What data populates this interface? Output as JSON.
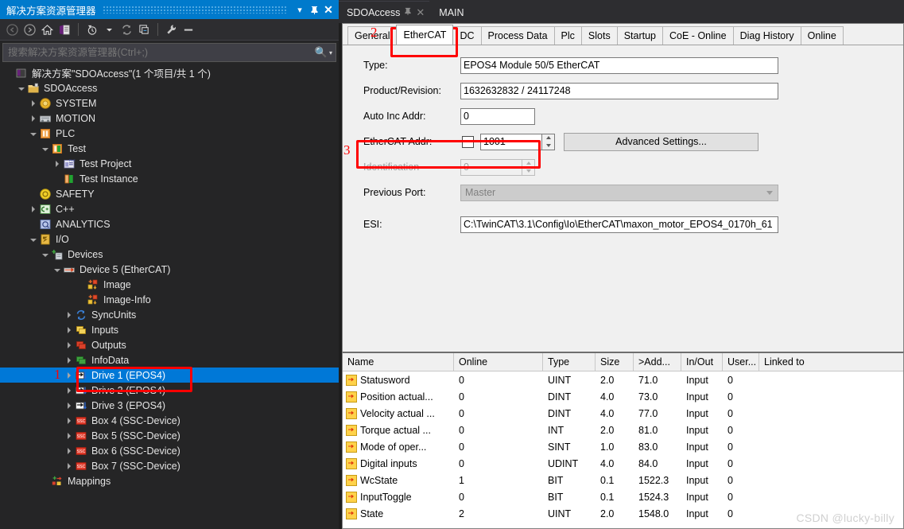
{
  "solution_explorer": {
    "title": "解决方案资源管理器",
    "titlebar_buttons": [
      {
        "name": "dropdown",
        "glyph": "▾"
      },
      {
        "name": "pin",
        "glyph": "⚲"
      },
      {
        "name": "close",
        "glyph": "✕"
      }
    ],
    "toolbar": [
      {
        "name": "back-icon",
        "glyph": "←"
      },
      {
        "name": "forward-icon",
        "glyph": "→"
      },
      {
        "name": "home-icon",
        "glyph": "⌂"
      },
      {
        "name": "solution-icon",
        "glyph": ""
      },
      {
        "name": "pending-changes-icon",
        "glyph": ""
      },
      {
        "name": "refresh-icon",
        "glyph": "⟳"
      },
      {
        "name": "collapse-all-icon",
        "glyph": ""
      },
      {
        "name": "properties-wrench-icon",
        "glyph": ""
      },
      {
        "name": "dash-icon",
        "glyph": "▬"
      }
    ],
    "search_placeholder": "搜索解决方案资源管理器(Ctrl+;)",
    "tree": [
      {
        "label": "解决方案\"SDOAccess\"(1 个项目/共 1 个)",
        "indent": 0,
        "twisty": "",
        "icon": "solution"
      },
      {
        "label": "SDOAccess",
        "indent": 1,
        "twisty": "open",
        "icon": "project"
      },
      {
        "label": "SYSTEM",
        "indent": 2,
        "twisty": "closed",
        "icon": "system"
      },
      {
        "label": "MOTION",
        "indent": 2,
        "twisty": "closed",
        "icon": "motion"
      },
      {
        "label": "PLC",
        "indent": 2,
        "twisty": "open",
        "icon": "plc"
      },
      {
        "label": "Test",
        "indent": 3,
        "twisty": "open",
        "icon": "plcproj"
      },
      {
        "label": "Test Project",
        "indent": 4,
        "twisty": "closed",
        "icon": "plcprog"
      },
      {
        "label": "Test Instance",
        "indent": 4,
        "twisty": "",
        "icon": "plcinst"
      },
      {
        "label": "SAFETY",
        "indent": 2,
        "twisty": "",
        "icon": "safety"
      },
      {
        "label": "C++",
        "indent": 2,
        "twisty": "closed",
        "icon": "cpp"
      },
      {
        "label": "ANALYTICS",
        "indent": 2,
        "twisty": "",
        "icon": "analytics"
      },
      {
        "label": "I/O",
        "indent": 2,
        "twisty": "open",
        "icon": "io"
      },
      {
        "label": "Devices",
        "indent": 3,
        "twisty": "open",
        "icon": "devices"
      },
      {
        "label": "Device 5 (EtherCAT)",
        "indent": 4,
        "twisty": "open",
        "icon": "ecatdev"
      },
      {
        "label": "Image",
        "indent": 6,
        "twisty": "",
        "icon": "image"
      },
      {
        "label": "Image-Info",
        "indent": 6,
        "twisty": "",
        "icon": "image"
      },
      {
        "label": "SyncUnits",
        "indent": 5,
        "twisty": "closed",
        "icon": "sync"
      },
      {
        "label": "Inputs",
        "indent": 5,
        "twisty": "closed",
        "icon": "inputs"
      },
      {
        "label": "Outputs",
        "indent": 5,
        "twisty": "closed",
        "icon": "outputs"
      },
      {
        "label": "InfoData",
        "indent": 5,
        "twisty": "closed",
        "icon": "infodata"
      },
      {
        "label": "Drive 1 (EPOS4)",
        "indent": 5,
        "twisty": "closed",
        "icon": "drive",
        "selected": true
      },
      {
        "label": "Drive 2 (EPOS4)",
        "indent": 5,
        "twisty": "closed",
        "icon": "drive"
      },
      {
        "label": "Drive 3 (EPOS4)",
        "indent": 5,
        "twisty": "closed",
        "icon": "drive"
      },
      {
        "label": "Box 4 (SSC-Device)",
        "indent": 5,
        "twisty": "closed",
        "icon": "ssc"
      },
      {
        "label": "Box 5 (SSC-Device)",
        "indent": 5,
        "twisty": "closed",
        "icon": "ssc"
      },
      {
        "label": "Box 6 (SSC-Device)",
        "indent": 5,
        "twisty": "closed",
        "icon": "ssc"
      },
      {
        "label": "Box 7 (SSC-Device)",
        "indent": 5,
        "twisty": "closed",
        "icon": "ssc"
      },
      {
        "label": "Mappings",
        "indent": 3,
        "twisty": "",
        "icon": "mappings"
      }
    ]
  },
  "document_tabs": [
    {
      "label": "SDOAccess",
      "active": true,
      "pin": "⚲",
      "close": "✕"
    },
    {
      "label": "MAIN",
      "active": false
    }
  ],
  "property_tabs": [
    {
      "label": "General",
      "active": false
    },
    {
      "label": "EtherCAT",
      "active": true
    },
    {
      "label": "DC",
      "active": false
    },
    {
      "label": "Process Data",
      "active": false
    },
    {
      "label": "Plc",
      "active": false
    },
    {
      "label": "Slots",
      "active": false
    },
    {
      "label": "Startup",
      "active": false
    },
    {
      "label": "CoE - Online",
      "active": false
    },
    {
      "label": "Diag History",
      "active": false
    },
    {
      "label": "Online",
      "active": false
    }
  ],
  "form": {
    "type_label": "Type:",
    "type_value": "EPOS4 Module 50/5 EtherCAT",
    "product_label": "Product/Revision:",
    "product_value": "1632632832 / 24117248",
    "autoinc_label": "Auto Inc Addr:",
    "autoinc_value": "0",
    "ecataddr_label": "EtherCAT Addr:",
    "ecataddr_value": "1001",
    "identification_label": "Identification",
    "identification_value": "0",
    "prevport_label": "Previous Port:",
    "prevport_value": "Master",
    "esi_label": "ESI:",
    "esi_value": "C:\\TwinCAT\\3.1\\Config\\Io\\EtherCAT\\maxon_motor_EPOS4_0170h_61",
    "advanced_button": "Advanced Settings..."
  },
  "grid": {
    "columns": [
      "Name",
      "Online",
      "Type",
      "Size",
      ">Add...",
      "In/Out",
      "User...",
      "Linked to"
    ],
    "rows": [
      {
        "name": "Statusword",
        "online": "0",
        "type": "UINT",
        "size": "2.0",
        "addr": "71.0",
        "inout": "Input",
        "user": "0",
        "linked": ""
      },
      {
        "name": "Position actual...",
        "online": "0",
        "type": "DINT",
        "size": "4.0",
        "addr": "73.0",
        "inout": "Input",
        "user": "0",
        "linked": ""
      },
      {
        "name": "Velocity actual ...",
        "online": "0",
        "type": "DINT",
        "size": "4.0",
        "addr": "77.0",
        "inout": "Input",
        "user": "0",
        "linked": ""
      },
      {
        "name": "Torque actual ...",
        "online": "0",
        "type": "INT",
        "size": "2.0",
        "addr": "81.0",
        "inout": "Input",
        "user": "0",
        "linked": ""
      },
      {
        "name": "Mode of oper...",
        "online": "0",
        "type": "SINT",
        "size": "1.0",
        "addr": "83.0",
        "inout": "Input",
        "user": "0",
        "linked": ""
      },
      {
        "name": "Digital inputs",
        "online": "0",
        "type": "UDINT",
        "size": "4.0",
        "addr": "84.0",
        "inout": "Input",
        "user": "0",
        "linked": ""
      },
      {
        "name": "WcState",
        "online": "1",
        "type": "BIT",
        "size": "0.1",
        "addr": "1522.3",
        "inout": "Input",
        "user": "0",
        "linked": ""
      },
      {
        "name": "InputToggle",
        "online": "0",
        "type": "BIT",
        "size": "0.1",
        "addr": "1524.3",
        "inout": "Input",
        "user": "0",
        "linked": ""
      },
      {
        "name": "State",
        "online": "2",
        "type": "UINT",
        "size": "2.0",
        "addr": "1548.0",
        "inout": "Input",
        "user": "0",
        "linked": ""
      }
    ]
  },
  "annotations": [
    {
      "number": "1",
      "target": "drive-1-tree-item"
    },
    {
      "number": "2",
      "target": "ethercat-property-tab"
    },
    {
      "number": "3",
      "target": "ethercat-addr-field"
    }
  ],
  "watermark": "CSDN @lucky-billy",
  "colors": {
    "accent_blue": "#007acc",
    "selection_blue": "#0078d7",
    "annotation_red": "#fe0000",
    "panel_bg": "#252526",
    "form_bg": "#f0f0f0"
  }
}
